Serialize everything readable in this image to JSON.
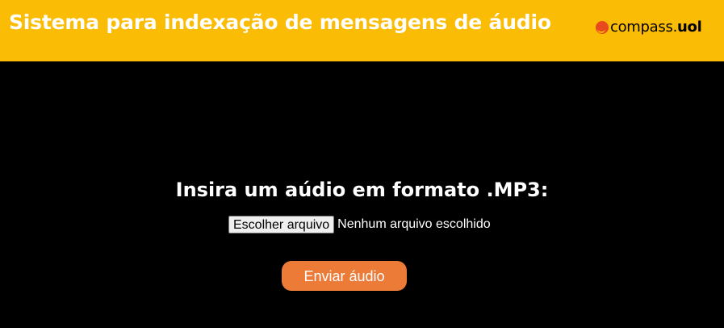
{
  "header": {
    "title": "Sistema para indexação de mensagens de áudio",
    "logo": {
      "brand": "compass",
      "separator": ".",
      "suffix": "uol",
      "dot_color": "#e8491d"
    },
    "background_color": "#fbbc05"
  },
  "main": {
    "heading": "Insira um aúdio em formato .MP3:",
    "file_input": {
      "button_label": "Escolher arquivo",
      "status_text": "Nenhum arquivo escolhido"
    },
    "submit": {
      "label": "Enviar áudio",
      "color": "#ec7b37"
    },
    "background_color": "#000000"
  }
}
